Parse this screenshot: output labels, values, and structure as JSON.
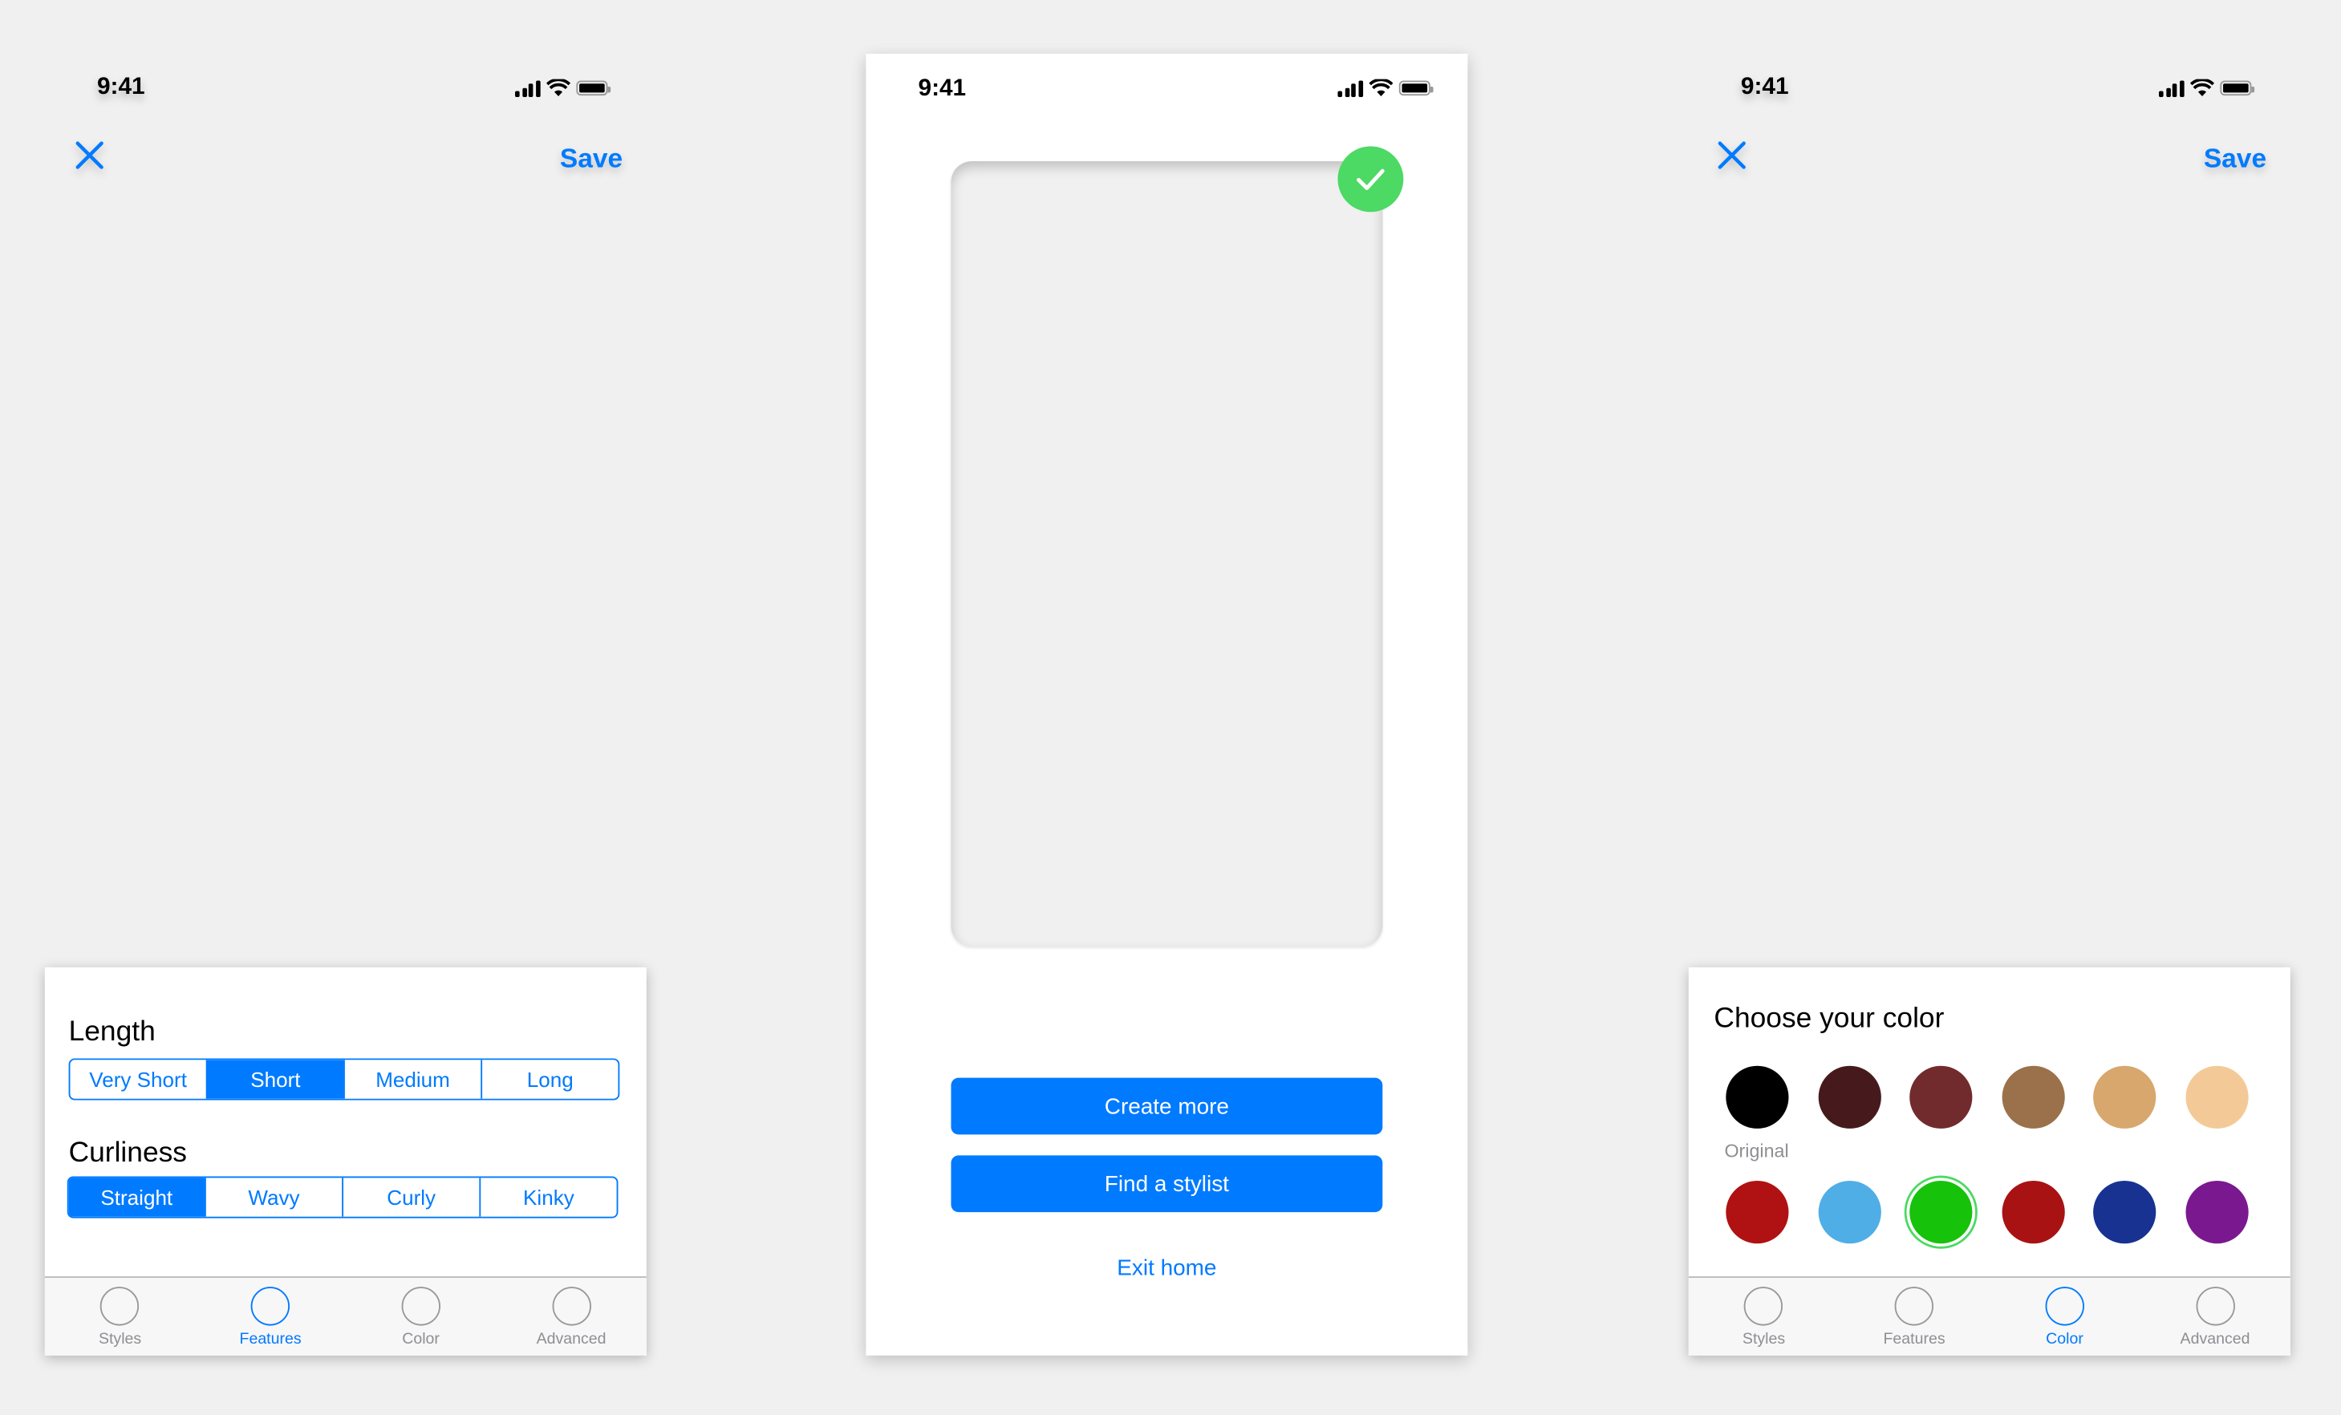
{
  "status_bar": {
    "time": "9:41"
  },
  "screen_features": {
    "nav": {
      "close_icon": "close-icon",
      "save_label": "Save"
    },
    "length": {
      "label": "Length",
      "options": [
        "Very Short",
        "Short",
        "Medium",
        "Long"
      ],
      "selected": "Short"
    },
    "curliness": {
      "label": "Curliness",
      "options": [
        "Straight",
        "Wavy",
        "Curly",
        "Kinky"
      ],
      "selected": "Straight"
    },
    "tabs": [
      {
        "label": "Styles",
        "active": false
      },
      {
        "label": "Features",
        "active": true
      },
      {
        "label": "Color",
        "active": false
      },
      {
        "label": "Advanced",
        "active": false
      }
    ]
  },
  "screen_result": {
    "check_icon": "checkmark-circle-icon",
    "buttons": {
      "create_more": "Create more",
      "find_stylist": "Find a stylist"
    },
    "exit_link": "Exit home"
  },
  "screen_color": {
    "nav": {
      "close_icon": "close-icon",
      "save_label": "Save"
    },
    "title": "Choose your color",
    "original_label": "Original",
    "swatches_row1": [
      "#000000",
      "#461a1c",
      "#722b2c",
      "#9b714b",
      "#d8a76d",
      "#f3ca97"
    ],
    "swatches_row2": [
      "#b01112",
      "#4faee6",
      "#17c20b",
      "#a91213",
      "#173291",
      "#7a1890"
    ],
    "selected_swatch": "#17c20b",
    "tabs": [
      {
        "label": "Styles",
        "active": false
      },
      {
        "label": "Features",
        "active": false
      },
      {
        "label": "Color",
        "active": true
      },
      {
        "label": "Advanced",
        "active": false
      }
    ]
  },
  "colors": {
    "accent": "#007aff",
    "success": "#4cd964",
    "background": "#f0f0f0"
  }
}
